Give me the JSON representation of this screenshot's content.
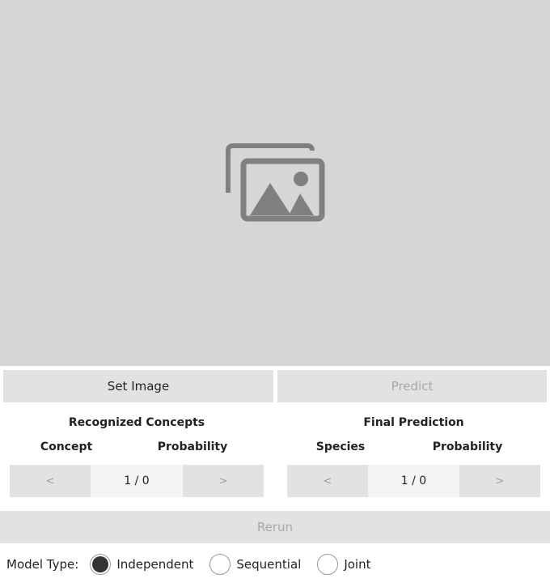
{
  "image_area": {
    "icon": "image-placeholder-icon"
  },
  "buttons": {
    "set_image": "Set Image",
    "predict": "Predict",
    "rerun": "Rerun"
  },
  "concepts_panel": {
    "title": "Recognized Concepts",
    "col_concept": "Concept",
    "col_probability": "Probability",
    "prev": "<",
    "next": ">",
    "page": "1 / 0"
  },
  "prediction_panel": {
    "title": "Final Prediction",
    "col_species": "Species",
    "col_probability": "Probability",
    "prev": "<",
    "next": ">",
    "page": "1 / 0"
  },
  "model_type": {
    "label": "Model Type:",
    "options": [
      "Independent",
      "Sequential",
      "Joint"
    ],
    "selected": "Independent"
  },
  "colors": {
    "image_bg": "#d6d6d6",
    "button_bg": "#e2e2e2",
    "icon": "#808080"
  }
}
